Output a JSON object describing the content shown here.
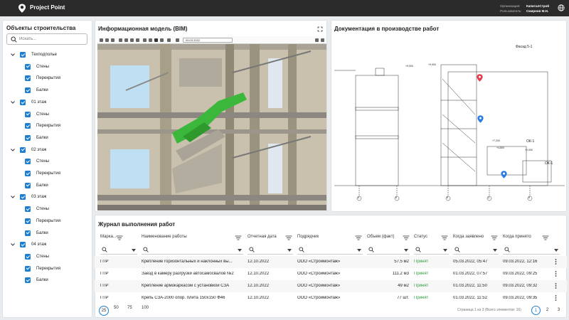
{
  "app": {
    "title": "Project Point",
    "org_label": "Организация:",
    "user_label": "Пользователь:",
    "org_value": "КапиталСтрой",
    "user_value": "Смирнов М.Н."
  },
  "left": {
    "title": "Объекты строительства",
    "search_placeholder": "Искать...",
    "groups": [
      {
        "label": "Техподполье",
        "children": [
          "Стены",
          "Перекрытия",
          "Балки"
        ]
      },
      {
        "label": "01 этаж",
        "children": [
          "Стены",
          "Перекрытия",
          "Балки"
        ]
      },
      {
        "label": "02 этаж",
        "children": [
          "Стены",
          "Перекрытия",
          "Балки"
        ]
      },
      {
        "label": "03 этаж",
        "children": [
          "Стены",
          "Перекрытия",
          "Балки"
        ]
      },
      {
        "label": "04 этаж",
        "children": [
          "Стены",
          "Перекрытия",
          "Балки"
        ]
      }
    ]
  },
  "bim": {
    "title": "Информационная модель (BIM)",
    "date": "09.03.2022"
  },
  "docs": {
    "title": "Документация в производстве работ",
    "sheet_label": "Фасад 5-1",
    "labels": [
      "ОК-1",
      "ОК-1",
      "+9,900",
      "+9,900",
      "+7,200",
      "+4,800",
      "+0,000"
    ],
    "axis_labels": [
      "4",
      "5",
      "5",
      "4",
      "5"
    ]
  },
  "journal": {
    "title": "Журнал выполнения работ",
    "columns": [
      "Марка...",
      "Наименование работы",
      "Отчетная дата",
      "Подрядчик",
      "Объем (факт)",
      "Статус",
      "Когда заявлено",
      "Когда принято"
    ],
    "rows": [
      [
        "ГПР",
        "Крепление горизонтальных и наклонных вы...",
        "12.10.2022",
        "ООО «Строймонтаж»",
        "57.5 м2",
        "Принят",
        "05.03.2022, 05:47",
        "09.03.2022, 12:16"
      ],
      [
        "ГПР",
        "Заезд в камеру разгрузки автосамосвалов №2",
        "12.10.2022",
        "ООО «Строймонтаж»",
        "111.2 м3",
        "Принят",
        "01.03.2022, 07:57",
        "09.03.2022, 09:25"
      ],
      [
        "ГПР",
        "Крепление армокаркасом с установкой СЗА",
        "12.10.2022",
        "ООО «Строймонтаж»",
        "49 м2",
        "Принят",
        "01.03.2022, 11:50",
        "09.03.2022, 09:32"
      ],
      [
        "ГПР",
        "Крепь СЗА-2000 опор. плита 150х150 Ф46",
        "12.10.2022",
        "ООО «Строймонтаж»",
        "77 шт.",
        "Принят",
        "01.03.2022, 11:52",
        "09.03.2022, 09:35"
      ]
    ],
    "page_sizes": [
      "25",
      "50",
      "75",
      "100"
    ],
    "page_info": "Страница 1 из 3 (Всего элементов: 16)",
    "pages": [
      "1",
      "2",
      "3"
    ]
  },
  "colors": {
    "accent": "#1e7fd0",
    "topbar": "#2b2b2b",
    "status_ok": "#2a9d3a",
    "model_green": "#3bb83b",
    "marker_red": "#e23b4b",
    "marker_blue": "#2a7de1"
  }
}
